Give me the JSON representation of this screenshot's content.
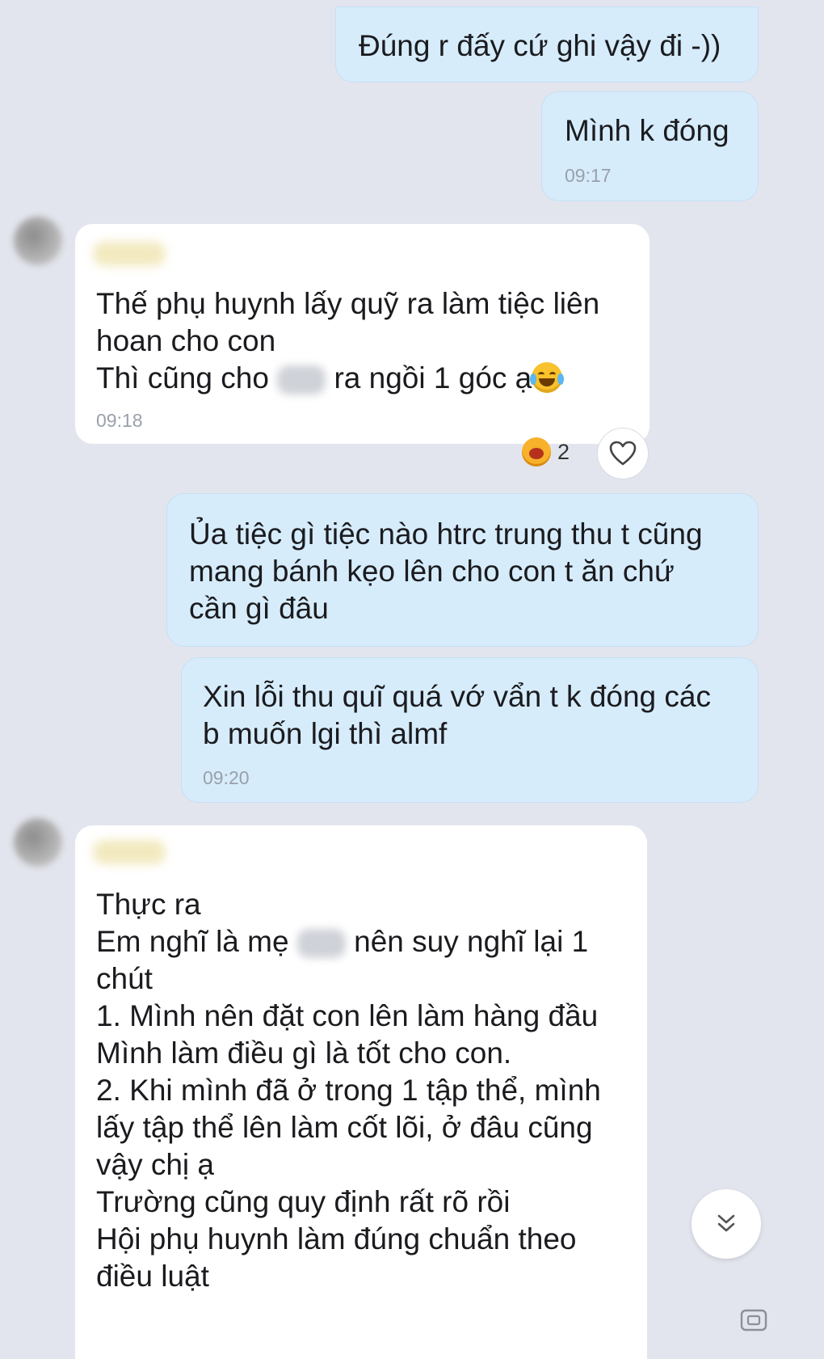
{
  "messages": [
    {
      "id": "m1",
      "lines": [
        "Đúng r đấy cứ ghi vậy đi -))"
      ],
      "time": ""
    },
    {
      "id": "m2",
      "lines": [
        "Mình k đóng"
      ],
      "time": "09:17"
    },
    {
      "id": "m3",
      "lines": [
        "Thế phụ huynh lấy quỹ ra làm tiệc liên",
        "hoan cho con"
      ],
      "line3_pre": "Thì cũng cho",
      "line3_post": "ra ngồi 1 góc ạ",
      "time": "09:18",
      "reaction_count": "2"
    },
    {
      "id": "m4",
      "lines": [
        "Ủa tiệc gì tiệc nào htrc trung thu t cũng",
        "mang bánh kẹo lên cho con t ăn chứ",
        "cần gì đâu"
      ]
    },
    {
      "id": "m5",
      "lines": [
        "Xin lỗi thu quĩ quá vớ vẩn t k đóng các",
        "b muốn lgi thì almf"
      ],
      "time": "09:20"
    },
    {
      "id": "m6",
      "line1": "Thực ra",
      "line2_pre": "Em nghĩ là mẹ",
      "line2_post": "nên suy nghĩ lại 1",
      "lines": [
        "chút",
        "1. Mình nên đặt con lên làm hàng đầu",
        "Mình làm điều gì là tốt cho con.",
        "2. Khi mình đã ở trong 1 tập thể, mình",
        "lấy tập thể lên làm cốt lõi, ở đâu cũng",
        "vậy chị ạ",
        "Trường cũng quy định rất rõ rồi",
        "Hội phụ huynh làm đúng chuẩn theo",
        "điều luật"
      ]
    }
  ],
  "icons": {
    "heart": "heart-outline-icon",
    "reaction": "crying-laugh-emoji",
    "scroll": "chevron-double-down-icon"
  },
  "colors": {
    "background": "#e3e5ee",
    "outgoing_bubble": "#d6ecfb",
    "incoming_bubble": "#ffffff",
    "timestamp": "#9aa0aa"
  }
}
